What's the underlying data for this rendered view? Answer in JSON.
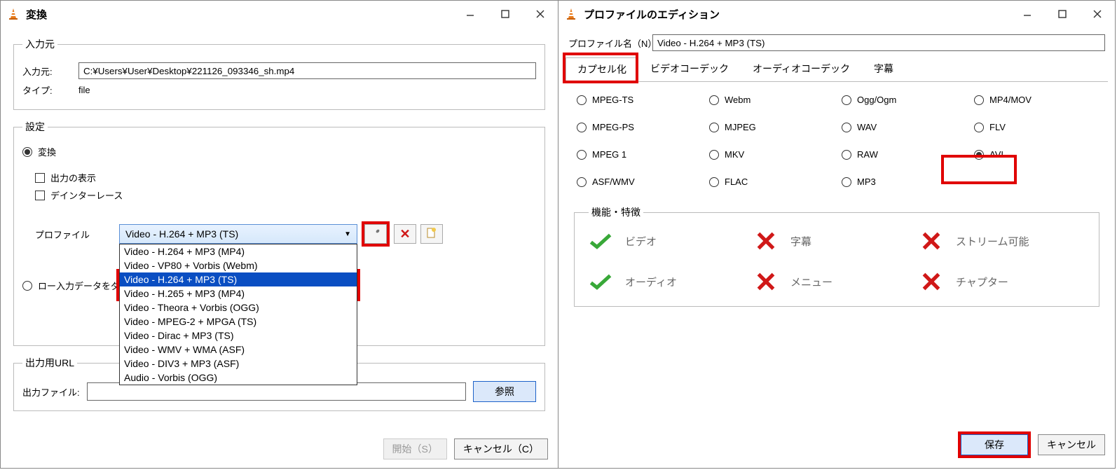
{
  "left": {
    "title": "変換",
    "sections": {
      "input_legend": "入力元",
      "input_label": "入力元:",
      "input_value": "C:¥Users¥User¥Desktop¥221126_093346_sh.mp4",
      "type_label": "タイプ:",
      "type_value": "file",
      "settings_legend": "設定",
      "radio_convert": "変換",
      "chk_show_output": "出力の表示",
      "chk_deinterlace": "デインターレース",
      "profile_label": "プロファイル",
      "combo_value": "Video - H.264 + MP3 (TS)",
      "dropdown": [
        "Video - H.264 + MP3 (MP4)",
        "Video - VP80 + Vorbis (Webm)",
        "Video - H.264 + MP3 (TS)",
        "Video - H.265 + MP3 (MP4)",
        "Video - Theora + Vorbis (OGG)",
        "Video - MPEG-2 + MPGA (TS)",
        "Video - Dirac + MP3 (TS)",
        "Video - WMV + WMA (ASF)",
        "Video - DIV3 + MP3 (ASF)",
        "Audio - Vorbis (OGG)"
      ],
      "dropdown_selected_index": 2,
      "radio_raw_dump": "ロー入力データをダンプ",
      "output_legend": "出力用URL",
      "output_file_label": "出力ファイル:",
      "output_file_value": "",
      "browse_btn": "参照",
      "start_btn": "開始（S）",
      "cancel_btn": "キャンセル（C）"
    }
  },
  "right": {
    "title": "プロファイルのエディション",
    "profile_name_label": "プロファイル名（N）",
    "profile_name_value": "Video - H.264 + MP3 (TS)",
    "tabs": [
      "カプセル化",
      "ビデオコーデック",
      "オーディオコーデック",
      "字幕"
    ],
    "active_tab": 0,
    "caps": [
      "MPEG-TS",
      "Webm",
      "Ogg/Ogm",
      "MP4/MOV",
      "MPEG-PS",
      "MJPEG",
      "WAV",
      "FLV",
      "MPEG 1",
      "MKV",
      "RAW",
      "AVI",
      "ASF/WMV",
      "FLAC",
      "MP3"
    ],
    "caps_selected": "AVI",
    "features_legend": "機能・特徴",
    "features": {
      "video": "ビデオ",
      "subs": "字幕",
      "stream": "ストリーム可能",
      "audio": "オーディオ",
      "menu": "メニュー",
      "chapter": "チャプター"
    },
    "save_btn": "保存",
    "cancel_btn": "キャンセル"
  }
}
